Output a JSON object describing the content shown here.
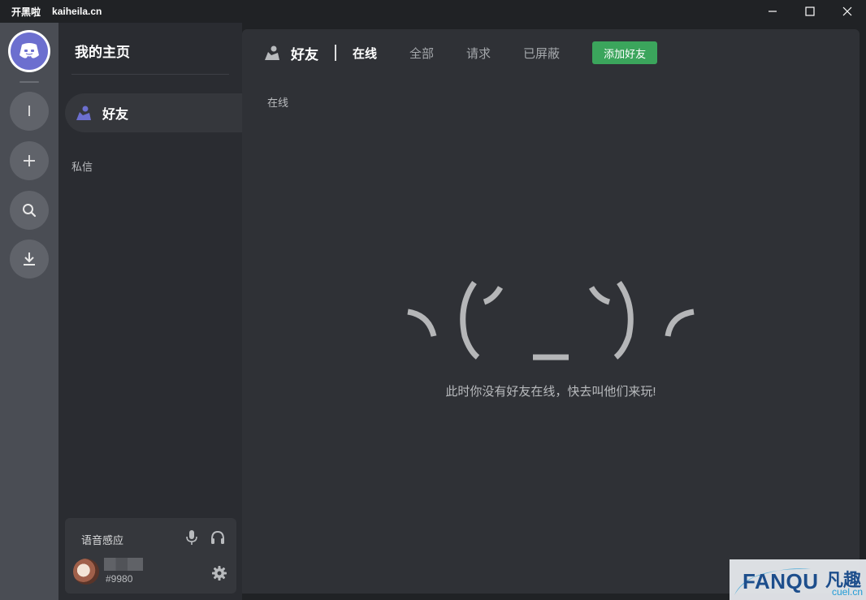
{
  "window": {
    "app_name": "开黑啦",
    "app_url": "kaiheila.cn"
  },
  "rail": {
    "home": "discord-logo-icon",
    "items": [
      "server-i-icon",
      "plus-icon",
      "search-icon",
      "download-icon"
    ],
    "first_server_letter": "I"
  },
  "sidebar": {
    "title": "我的主页",
    "friends_label": "好友",
    "dm_label": "私信"
  },
  "user_panel": {
    "voice_mode": "语音感应",
    "tag": "#9980"
  },
  "main": {
    "header_title": "好友",
    "tabs": [
      {
        "label": "在线",
        "active": true
      },
      {
        "label": "全部",
        "active": false
      },
      {
        "label": "请求",
        "active": false
      },
      {
        "label": "已屏蔽",
        "active": false
      }
    ],
    "add_friend_label": "添加好友",
    "section_label": "在线",
    "empty_message": "此时你没有好友在线，快去叫他们来玩!"
  },
  "watermark": {
    "text": "FANQU",
    "cn": "凡趣",
    "domain": "cuel.cn"
  },
  "colors": {
    "accent": "#6c6fcf",
    "add_friend": "#3ba55c",
    "background": "#2f3136"
  }
}
